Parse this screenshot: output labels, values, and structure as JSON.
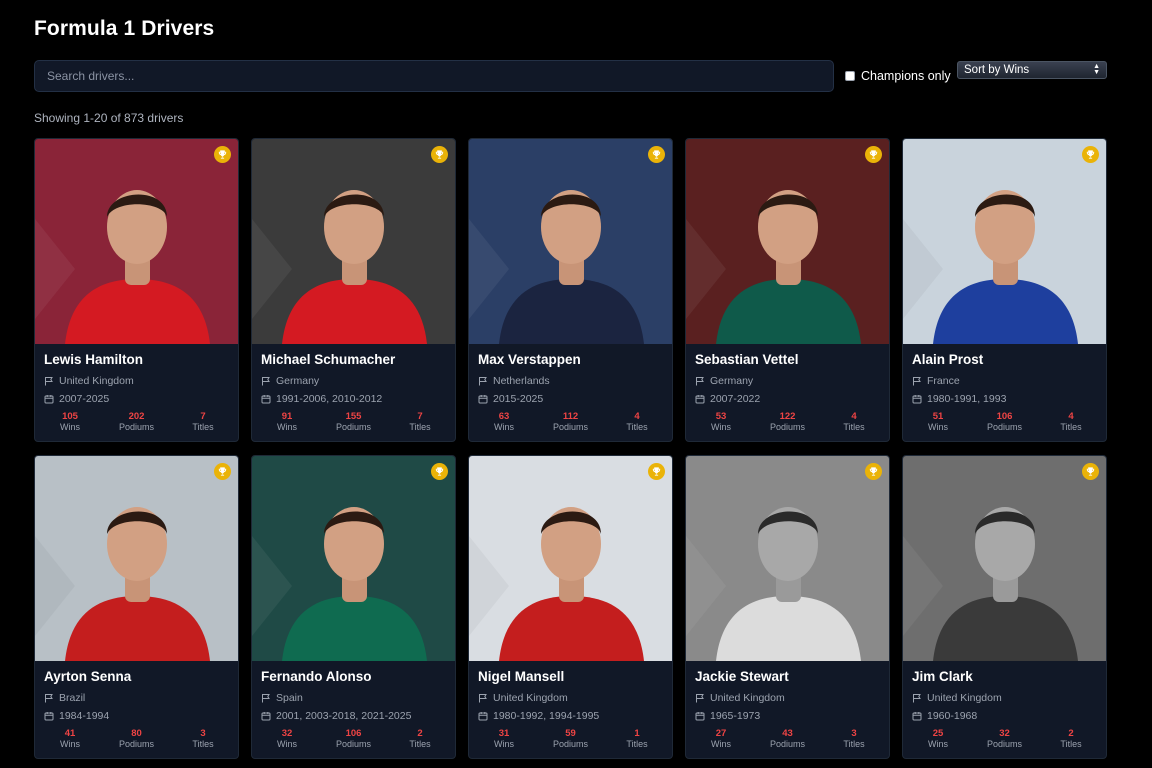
{
  "header": {
    "title": "Formula 1 Drivers"
  },
  "search": {
    "placeholder": "Search drivers..."
  },
  "filters": {
    "champions_only_label": "Champions only",
    "sort_label": "Sort by Wins"
  },
  "results": {
    "showing": "Showing 1-20 of 873 drivers"
  },
  "stat_labels": {
    "wins": "Wins",
    "podiums": "Podiums",
    "titles": "Titles"
  },
  "drivers": [
    {
      "name": "Lewis Hamilton",
      "country": "United Kingdom",
      "years": "2007-2025",
      "wins": "105",
      "podiums": "202",
      "titles": "7",
      "bg": "#8a2438",
      "suit": "#d41a22"
    },
    {
      "name": "Michael Schumacher",
      "country": "Germany",
      "years": "1991-2006, 2010-2012",
      "wins": "91",
      "podiums": "155",
      "titles": "7",
      "bg": "#3b3b3b",
      "suit": "#d41a22"
    },
    {
      "name": "Max Verstappen",
      "country": "Netherlands",
      "years": "2015-2025",
      "wins": "63",
      "podiums": "112",
      "titles": "4",
      "bg": "#2b3f66",
      "suit": "#1b2440"
    },
    {
      "name": "Sebastian Vettel",
      "country": "Germany",
      "years": "2007-2022",
      "wins": "53",
      "podiums": "122",
      "titles": "4",
      "bg": "#5a2020",
      "suit": "#0f5a4a"
    },
    {
      "name": "Alain Prost",
      "country": "France",
      "years": "1980-1991, 1993",
      "wins": "51",
      "podiums": "106",
      "titles": "4",
      "bg": "#c9d3dc",
      "suit": "#1e3f9e"
    },
    {
      "name": "Ayrton Senna",
      "country": "Brazil",
      "years": "1984-1994",
      "wins": "41",
      "podiums": "80",
      "titles": "3",
      "bg": "#b8c0c6",
      "suit": "#c41e1e"
    },
    {
      "name": "Fernando Alonso",
      "country": "Spain",
      "years": "2001, 2003-2018, 2021-2025",
      "wins": "32",
      "podiums": "106",
      "titles": "2",
      "bg": "#1f4a46",
      "suit": "#0f6b50"
    },
    {
      "name": "Nigel Mansell",
      "country": "United Kingdom",
      "years": "1980-1992, 1994-1995",
      "wins": "31",
      "podiums": "59",
      "titles": "1",
      "bg": "#d9dde2",
      "suit": "#c41e1e"
    },
    {
      "name": "Jackie Stewart",
      "country": "United Kingdom",
      "years": "1965-1973",
      "wins": "27",
      "podiums": "43",
      "titles": "3",
      "bg": "#8a8a8a",
      "suit": "#dcdcdc"
    },
    {
      "name": "Jim Clark",
      "country": "United Kingdom",
      "years": "1960-1968",
      "wins": "25",
      "podiums": "32",
      "titles": "2",
      "bg": "#6e6e6e",
      "suit": "#3a3a3a"
    }
  ]
}
